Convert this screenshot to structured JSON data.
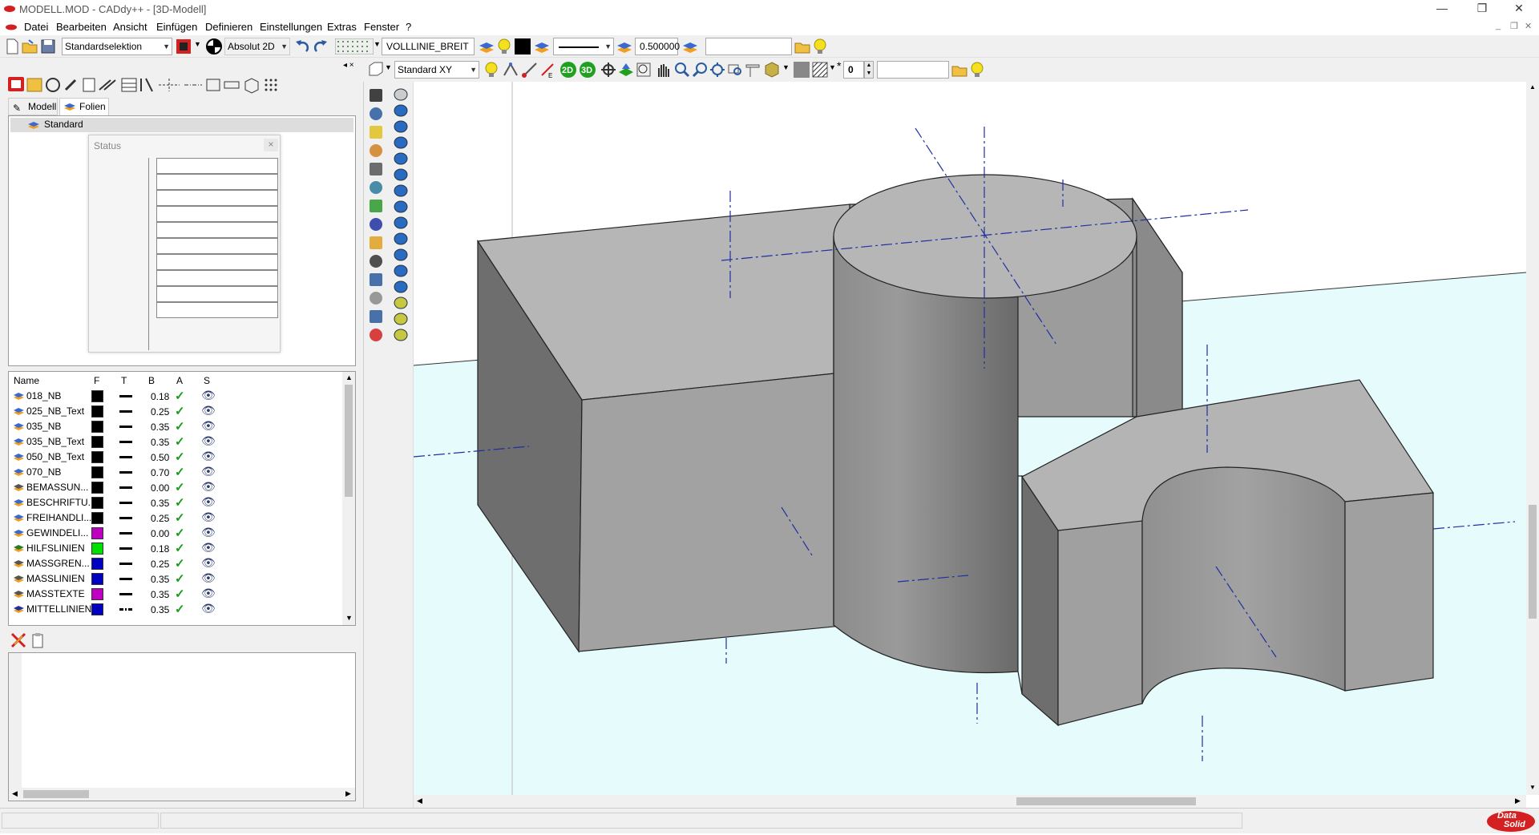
{
  "window": {
    "title": "MODELL.MOD  -  CADdy++ - [3D-Modell]",
    "controls": [
      "—",
      "❐",
      "✕"
    ]
  },
  "menu": [
    "Datei",
    "Bearbeiten",
    "Ansicht",
    "Einfügen",
    "Definieren",
    "Einstellungen",
    "Extras",
    "Fenster",
    "?"
  ],
  "mdi_controls": [
    "_",
    "❐",
    "✕"
  ],
  "toolbar1": {
    "selection_mode": "Standardselektion",
    "coord_mode": "Absolut 2D",
    "layer_name": "VOLLLINIE_BREIT",
    "line_width": "0.500000",
    "search_value": ""
  },
  "toolbar2": {
    "view_mode": "Standard XY",
    "btn_2d": "2D",
    "btn_3d": "3D",
    "level_value": "0",
    "value_field": ""
  },
  "leftpanel": {
    "tabs": [
      "Modell",
      "Folien"
    ],
    "active_tab": "Folien",
    "tree_root": "Standard",
    "status_window": {
      "title": "Status",
      "close": "×",
      "rows": 10
    },
    "layer_columns": [
      "Name",
      "F",
      "T",
      "B",
      "A",
      "S"
    ],
    "layers": [
      {
        "name": "018_NB",
        "color": "#000000",
        "width": "0.18",
        "icon": "layer"
      },
      {
        "name": "025_NB_Text",
        "color": "#000000",
        "width": "0.25",
        "icon": "layer"
      },
      {
        "name": "035_NB",
        "color": "#000000",
        "width": "0.35",
        "icon": "layer"
      },
      {
        "name": "035_NB_Text",
        "color": "#000000",
        "width": "0.35",
        "icon": "layer"
      },
      {
        "name": "050_NB_Text",
        "color": "#000000",
        "width": "0.50",
        "icon": "layer"
      },
      {
        "name": "070_NB",
        "color": "#000000",
        "width": "0.70",
        "icon": "layer"
      },
      {
        "name": "BEMASSUN...",
        "color": "#000000",
        "width": "0.00",
        "icon": "dim"
      },
      {
        "name": "BESCHRIFTU...",
        "color": "#000000",
        "width": "0.35",
        "icon": "text"
      },
      {
        "name": "FREIHANDLI...",
        "color": "#000000",
        "width": "0.25",
        "icon": "layer"
      },
      {
        "name": "GEWINDELI...",
        "color": "#c000c0",
        "width": "0.00",
        "icon": "thread"
      },
      {
        "name": "HILFSLINIEN",
        "color": "#00e000",
        "width": "0.18",
        "icon": "help"
      },
      {
        "name": "MASSGREN...",
        "color": "#0000c0",
        "width": "0.25",
        "icon": "dim"
      },
      {
        "name": "MASSLINIEN",
        "color": "#0000c0",
        "width": "0.35",
        "icon": "dim"
      },
      {
        "name": "MASSTEXTE",
        "color": "#c000c0",
        "width": "0.35",
        "icon": "dim"
      },
      {
        "name": "MITTELLINIEN",
        "color": "#0000c0",
        "width": "0.35",
        "icon": "center"
      }
    ]
  },
  "brand": {
    "line1": "Data",
    "line2": "Solid"
  },
  "colors": {
    "accent_red": "#d42020",
    "floor": "#e6fbfc",
    "centerline": "#2030a0",
    "solid_light": "#b4b4b4",
    "solid_dark": "#6e6e6e"
  }
}
